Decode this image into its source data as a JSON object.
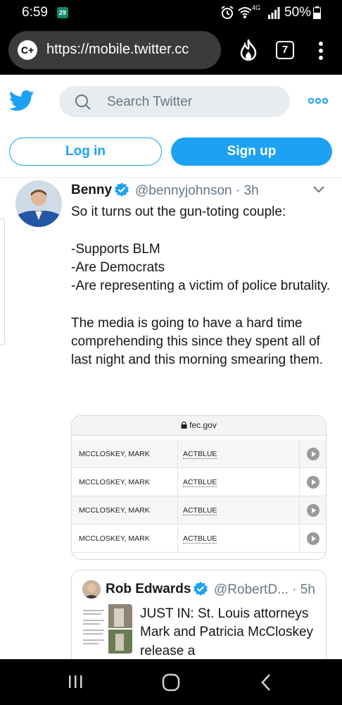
{
  "status_bar": {
    "time": "6:59",
    "calendar_badge": "29",
    "network": "4G",
    "battery": "50%"
  },
  "browser": {
    "url": "https://mobile.twitter.cc",
    "tab_count": "7",
    "site_icon": "C+"
  },
  "twitter": {
    "search_placeholder": "Search Twitter",
    "login_label": "Log in",
    "signup_label": "Sign up"
  },
  "tweet": {
    "name": "Benny",
    "handle_time": "@bennyjohnson · 3h",
    "body": "So it turns out the gun-toting couple:\n\n-Supports BLM\n-Are Democrats\n-Are representing a victim of police brutality.\n\nThe media is going to have a hard time comprehending this since they spent all of last night and this morning smearing them."
  },
  "media": {
    "domain": "fec.gov",
    "rows": [
      {
        "name": "MCCLOSKEY, MARK",
        "committee": "ACTBLUE"
      },
      {
        "name": "MCCLOSKEY, MARK",
        "committee": "ACTBLUE"
      },
      {
        "name": "MCCLOSKEY, MARK",
        "committee": "ACTBLUE"
      },
      {
        "name": "MCCLOSKEY, MARK",
        "committee": "ACTBLUE"
      }
    ]
  },
  "quoted_tweet": {
    "name": "Rob Edwards",
    "handle_time": "@RobertD... · 5h",
    "text": "JUST IN: St. Louis attorneys Mark and Patricia McCloskey release a"
  },
  "colors": {
    "twitter_blue": "#1da1f2",
    "text": "#14171a",
    "secondary_text": "#657786"
  }
}
